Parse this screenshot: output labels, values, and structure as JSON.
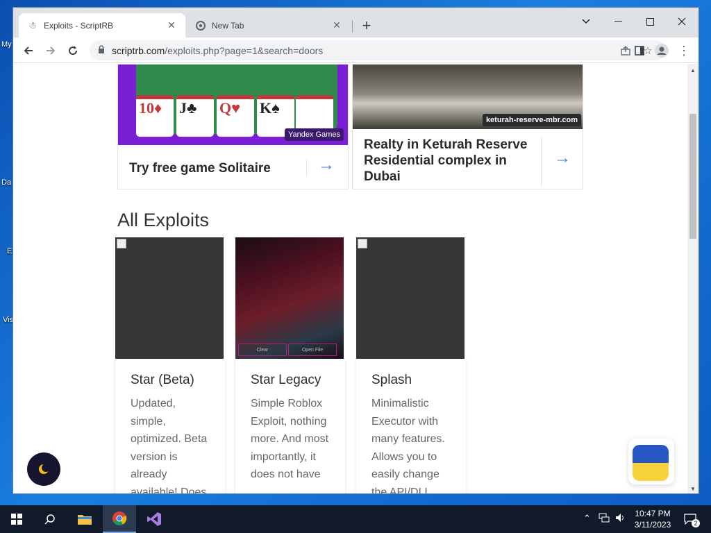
{
  "desktop": {
    "icon_labels": [
      "My",
      "Da",
      "E",
      "Vis"
    ]
  },
  "browser": {
    "tabs": [
      {
        "title": "Exploits - ScriptRB",
        "active": true
      },
      {
        "title": "New Tab",
        "active": false
      }
    ],
    "url_host": "scriptrb.com",
    "url_path": "/exploits.php?page=1&search=doors"
  },
  "ads": [
    {
      "text": "Try free game Solitaire",
      "badge": "Yandex Games",
      "cards": [
        "10♦",
        "J♣",
        "Q♥",
        "K♠"
      ]
    },
    {
      "text": "Realty in Keturah Reserve Residential complex in Dubai",
      "badge": "keturah-reserve-mbr.com"
    }
  ],
  "section_title": "All Exploits",
  "exploits": [
    {
      "name": "Star (Beta)",
      "description": "Updated, simple, optimized. Beta version is already available! Does"
    },
    {
      "name": "Star Legacy",
      "description": "Simple Roblox Exploit, nothing more. And most importantly, it does not have"
    },
    {
      "name": "Splash",
      "description": "Minimalistic Executor with many features. Allows you to easily change the API/DLL"
    }
  ],
  "legacy_buttons": [
    "Clear",
    "Open File"
  ],
  "taskbar": {
    "time": "10:47 PM",
    "date": "3/11/2023",
    "notification_count": "2"
  },
  "colors": {
    "accent_arrow": "#3a7bd5",
    "flag_blue": "#2858c6",
    "flag_yellow": "#f8d23a"
  }
}
